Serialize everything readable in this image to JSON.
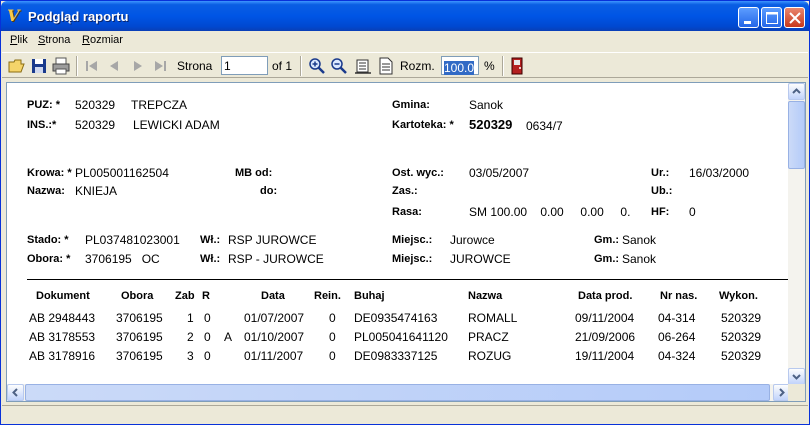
{
  "window": {
    "title": "Podgląd raportu"
  },
  "menu": [
    {
      "label": "Plik",
      "accel": "P",
      "rest": "lik"
    },
    {
      "label": "Strona",
      "accel": "S",
      "rest": "trona"
    },
    {
      "label": "Rozmiar",
      "accel": "R",
      "rest": "ozmiar"
    }
  ],
  "toolbar": {
    "page_label": "Strona",
    "page_value": "1",
    "page_total": "of 1",
    "zoom_label": "Rozm.",
    "zoom_value": "100.0",
    "zoom_unit": "%"
  },
  "report": {
    "puz_label": "PUZ: *",
    "puz_code": "520329",
    "puz_name": "TREPCZA",
    "ins_label": "INS.:*",
    "ins_code": "520329",
    "ins_name": "LEWICKI ADAM",
    "gmina_label": "Gmina:",
    "gmina_value": "Sanok",
    "kartoteka_label": "Kartoteka: *",
    "kartoteka_num": "520329",
    "kartoteka_sub": "0634/7",
    "krowa_label": "Krowa: *",
    "krowa_value": "PL005001162504",
    "nazwa_label": "Nazwa:",
    "nazwa_value": "KNIEJA",
    "mb_label": "MB  od:",
    "do_label": "do:",
    "ost_label": "Ost. wyc.:",
    "ost_value": "03/05/2007",
    "zas_label": "Zas.:",
    "rasa_label": "Rasa:",
    "rasa_value": "SM 100.00    0.00     0.00     0.",
    "ur_label": "Ur.:",
    "ur_value": "16/03/2000",
    "ub_label": "Ub.:",
    "hf_label": "HF:",
    "hf_value": "0",
    "stado_label": "Stado: *",
    "stado_value": "PL037481023001",
    "wl1_label": "Wł.:",
    "wl1_value": "RSP JUROWCE",
    "miejsc1_label": "Miejsc.:",
    "miejsc1_value": "Jurowce",
    "gm1_label": "Gm.:",
    "gm1_value": "Sanok",
    "obora_label": "Obora: *",
    "obora_value": "3706195   OC",
    "wl2_label": "Wł.:",
    "wl2_value": "RSP - JUROWCE",
    "miejsc2_label": "Miejsc.:",
    "miejsc2_value": "JUROWCE",
    "gm2_label": "Gm.:",
    "gm2_value": "Sanok",
    "columns": {
      "dokument": "Dokument",
      "obora": "Obora",
      "zab": "Zab",
      "r": "R",
      "data": "Data",
      "rein": "Rein.",
      "buhaj": "Buhaj",
      "nazwa": "Nazwa",
      "data_prod": "Data prod.",
      "nr_nas": "Nr nas.",
      "wykon": "Wykon."
    },
    "rows": [
      {
        "dokument": "AB 2948443",
        "obora": "3706195",
        "zab": "1",
        "r": "0",
        "flag": "",
        "data": "01/07/2007",
        "rein": "0",
        "buhaj": "DE0935474163",
        "nazwa": "ROMALL",
        "data_prod": "09/11/2004",
        "nr_nas": "04-314",
        "wykon": "520329"
      },
      {
        "dokument": "AB 3178553",
        "obora": "3706195",
        "zab": "2",
        "r": "0",
        "flag": "A",
        "data": "01/10/2007",
        "rein": "0",
        "buhaj": "PL005041641120",
        "nazwa": "PRACZ",
        "data_prod": "21/09/2006",
        "nr_nas": "06-264",
        "wykon": "520329"
      },
      {
        "dokument": "AB 3178916",
        "obora": "3706195",
        "zab": "3",
        "r": "0",
        "flag": "",
        "data": "01/11/2007",
        "rein": "0",
        "buhaj": "DE0983337125",
        "nazwa": "ROZUG",
        "data_prod": "19/11/2004",
        "nr_nas": "04-324",
        "wykon": "520329"
      }
    ]
  }
}
